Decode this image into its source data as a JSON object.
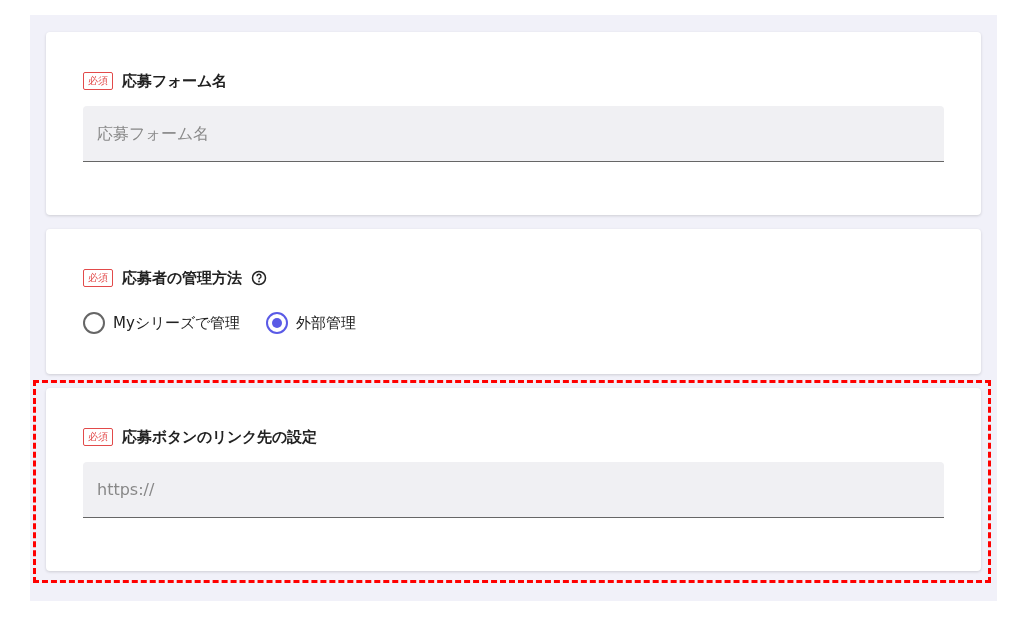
{
  "sections": [
    {
      "kind": "text",
      "required_badge": "必須",
      "label": "応募フォーム名",
      "help": false,
      "placeholder": "応募フォーム名",
      "highlighted": false
    },
    {
      "kind": "radio",
      "required_badge": "必須",
      "label": "応募者の管理方法",
      "help": true,
      "options": [
        {
          "label": "Myシリーズで管理",
          "selected": false
        },
        {
          "label": "外部管理",
          "selected": true
        }
      ],
      "highlighted": false
    },
    {
      "kind": "text",
      "required_badge": "必須",
      "label": "応募ボタンのリンク先の設定",
      "help": false,
      "placeholder": "https://",
      "highlighted": true
    }
  ]
}
